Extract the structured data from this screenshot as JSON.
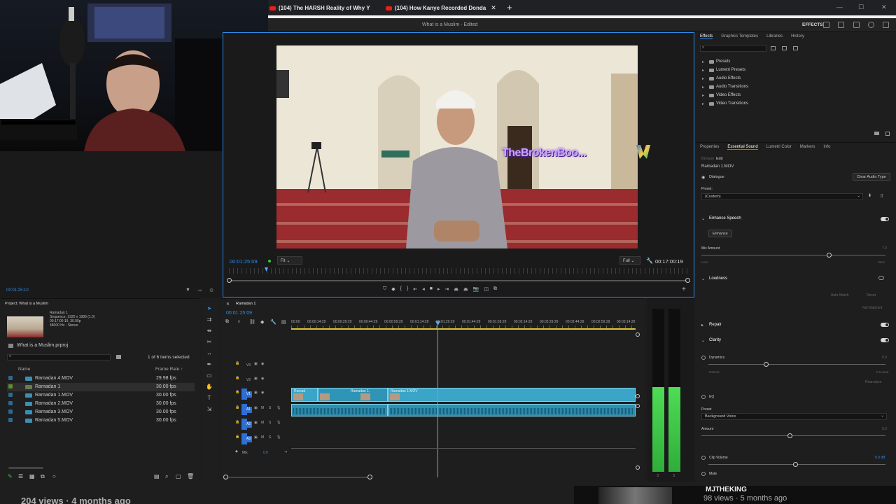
{
  "browser": {
    "tabs": [
      {
        "label": "(104) The HARSH Reality of Why Y"
      },
      {
        "label": "(104) How Kanye Recorded Donda"
      }
    ],
    "new_tab": "+"
  },
  "app": {
    "title": "What is a Muslim - Edited",
    "workspace": "EFFECTS"
  },
  "source": {
    "timecode": "00:01:25:10"
  },
  "program": {
    "overlay_text": "TheBrokenBoo...",
    "timecode": "00:01:25:09",
    "fit": "Fit",
    "quality": "Full",
    "duration": "00:17:00:19"
  },
  "effects_panel": {
    "tabs": [
      "Effects",
      "Graphics Templates",
      "Libraries",
      "History"
    ],
    "items": [
      "Presets",
      "Lumetri Presets",
      "Audio Effects",
      "Audio Transitions",
      "Video Effects",
      "Video Transitions"
    ]
  },
  "essential_sound": {
    "tabs": [
      "Properties",
      "Essential Sound",
      "Lumetri Color",
      "Markers",
      "Info"
    ],
    "subtabs": [
      "Browse",
      "Edit"
    ],
    "clip_name": "Ramadan 1.MOV",
    "type": "Dialogue",
    "clear_button": "Clear Audio Type",
    "preset_label": "Preset:",
    "preset_value": "(Custom)",
    "enhance_speech": "Enhance Speech",
    "enhance_button": "Enhance",
    "mix_amount": "Mix Amount",
    "mix_value": "7.0",
    "less": "Less",
    "more": "More",
    "loudness": "Loudness",
    "auto_match": "Auto-Match",
    "reset": "Reset",
    "not_matched": "Not Matched",
    "repair": "Repair",
    "clarity": "Clarity",
    "dynamics": "Dynamics",
    "dynamics_value": "5.0",
    "natural": "Natural",
    "focused": "Focused",
    "reanalyze": "Reanalyze",
    "eq": "EQ",
    "eq_preset_label": "Preset",
    "eq_preset_value": "Background Voice",
    "amount": "Amount",
    "amount_value": "5.0",
    "clip_volume": "Clip Volume",
    "clip_volume_value": "0.0 dB",
    "mute": "Mute"
  },
  "project": {
    "title": "Project: What is a Muslim",
    "seq_name": "Ramadan 1",
    "seq_info": [
      "Sequence, 1920 x 1080 (1.0)",
      "00:17:00:19, 30.00p",
      "48000 Hz - Stereo"
    ],
    "file": "What is a Muslim.prproj",
    "selection": "1 of 6 items selected",
    "col_name": "Name",
    "col_rate": "Frame Rate ↑",
    "rows": [
      {
        "name": "Ramadan 4.MOV",
        "rate": "29.98 fps"
      },
      {
        "name": "Ramadan 1",
        "rate": "30.00 fps"
      },
      {
        "name": "Ramadan 1.MOV",
        "rate": "30.00 fps"
      },
      {
        "name": "Ramadan 2.MOV",
        "rate": "30.00 fps"
      },
      {
        "name": "Ramadan 3.MOV",
        "rate": "30.00 fps"
      },
      {
        "name": "Ramadan 5.MOV",
        "rate": "30.00 fps"
      }
    ]
  },
  "timeline": {
    "sequence_tab": "Ramadan 1",
    "timecode": "00:01:25:09",
    "ruler": [
      "00:00",
      "00:00:14:29",
      "00:00:29:29",
      "00:00:44:29",
      "00:00:59:29",
      "00:01:14:29",
      "00:01:29:29",
      "00:01:44:29",
      "00:01:59:29",
      "00:02:14:29",
      "00:02:29:29",
      "00:02:44:29",
      "00:02:59:29",
      "00:03:14:29"
    ],
    "tracks": [
      "V3",
      "V2",
      "V1",
      "A1",
      "A2",
      "A3"
    ],
    "mix_label": "Mix",
    "mix_value": "0.0",
    "clips": [
      "Ramad",
      "Ramadan 1.",
      "Ramadan 1.MOV"
    ]
  },
  "meter": {
    "labels": [
      "S",
      "S"
    ]
  },
  "youtube": {
    "channel": "MJTHEKING",
    "meta": "98 views · 5 months ago",
    "left_meta": "204 views · 4 months ago"
  }
}
